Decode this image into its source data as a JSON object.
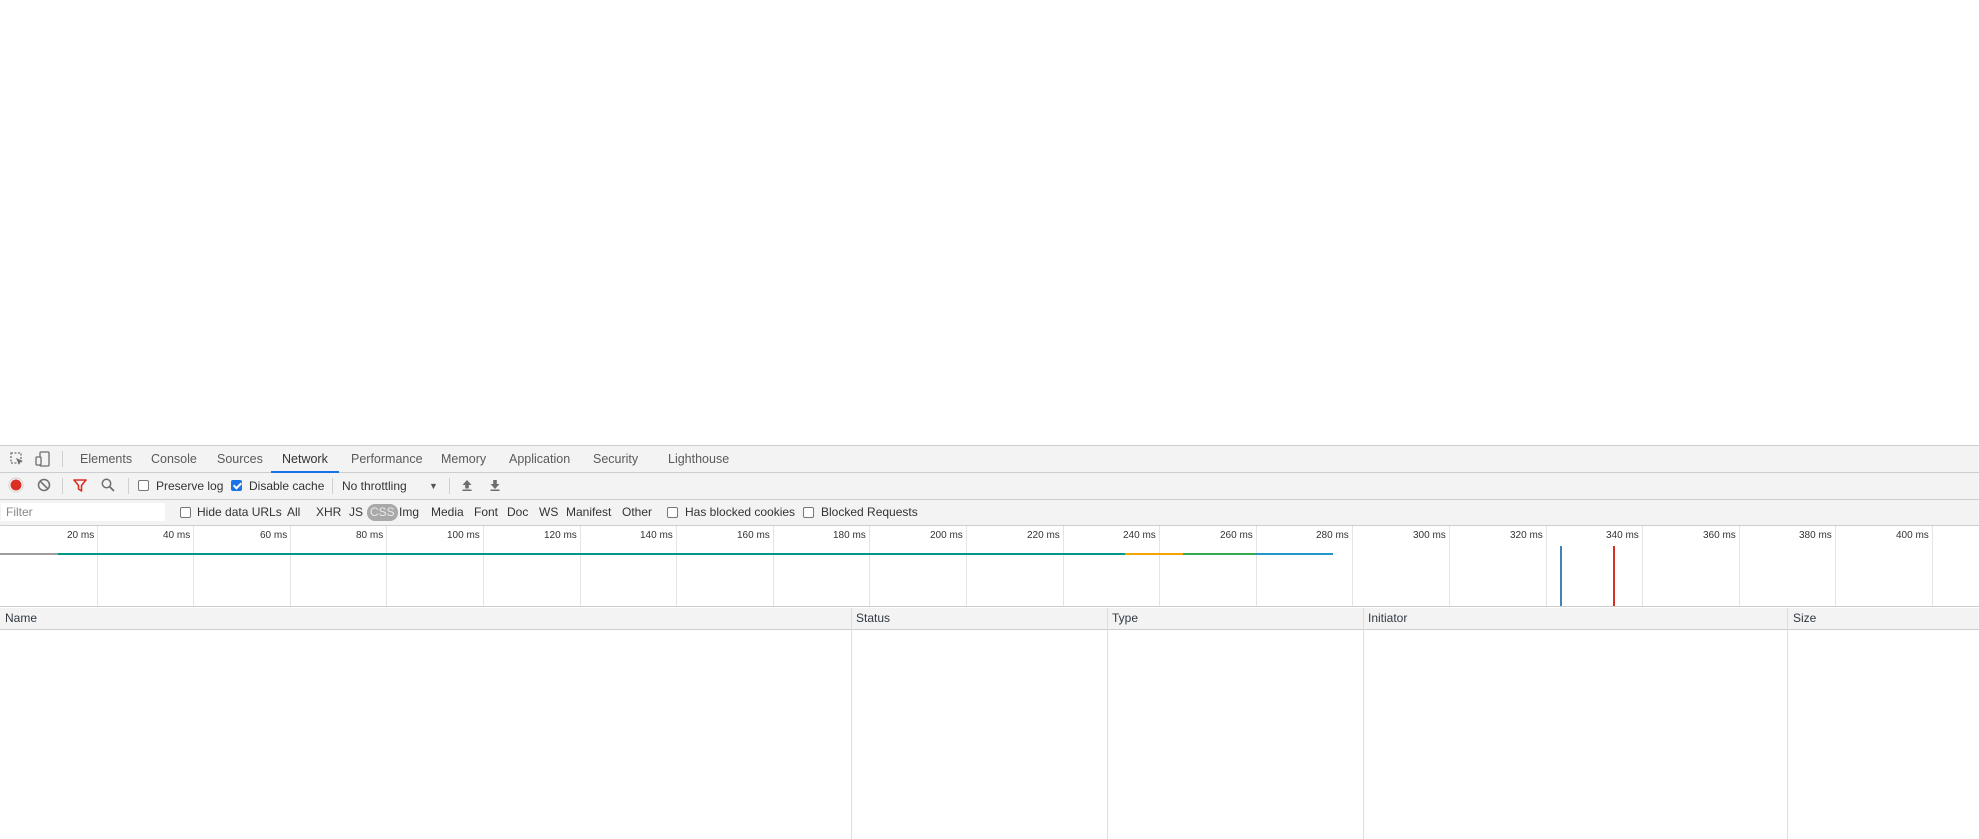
{
  "tabs": [
    {
      "label": "Elements"
    },
    {
      "label": "Console"
    },
    {
      "label": "Sources"
    },
    {
      "label": "Network",
      "active": true
    },
    {
      "label": "Performance"
    },
    {
      "label": "Memory"
    },
    {
      "label": "Application"
    },
    {
      "label": "Security"
    },
    {
      "label": "Lighthouse"
    }
  ],
  "toolbar": {
    "preserve_log_label": "Preserve log",
    "preserve_log_checked": false,
    "disable_cache_label": "Disable cache",
    "disable_cache_checked": true,
    "throttling_value": "No throttling",
    "record_color": "#d93025",
    "filter_icon_color": "#d93025"
  },
  "filterbar": {
    "placeholder": "Filter",
    "hide_data_urls_label": "Hide data URLs",
    "types": [
      "All",
      "XHR",
      "JS",
      "CSS",
      "Img",
      "Media",
      "Font",
      "Doc",
      "WS",
      "Manifest",
      "Other"
    ],
    "selected_type": "CSS",
    "has_blocked_cookies_label": "Has blocked cookies",
    "blocked_requests_label": "Blocked Requests"
  },
  "overview": {
    "ticks": [
      "20 ms",
      "40 ms",
      "60 ms",
      "80 ms",
      "100 ms",
      "120 ms",
      "140 ms",
      "160 ms",
      "180 ms",
      "200 ms",
      "220 ms",
      "240 ms",
      "260 ms",
      "280 ms",
      "300 ms",
      "320 ms",
      "340 ms",
      "360 ms",
      "380 ms",
      "400 ms"
    ],
    "segments": [
      {
        "from_ms": 0,
        "to_ms": 12,
        "color": "#9e9e9e"
      },
      {
        "from_ms": 12,
        "to_ms": 233,
        "color": "#009688"
      },
      {
        "from_ms": 233,
        "to_ms": 245,
        "color": "#f6a500"
      },
      {
        "from_ms": 245,
        "to_ms": 260,
        "color": "#34a853"
      },
      {
        "from_ms": 260,
        "to_ms": 276,
        "color": "#2196c8"
      }
    ],
    "markers": [
      {
        "at_ms": 323,
        "color": "#4285b4"
      },
      {
        "at_ms": 334,
        "color": "#d93025"
      }
    ]
  },
  "table": {
    "columns": [
      "Name",
      "Status",
      "Type",
      "Initiator",
      "Size"
    ]
  }
}
